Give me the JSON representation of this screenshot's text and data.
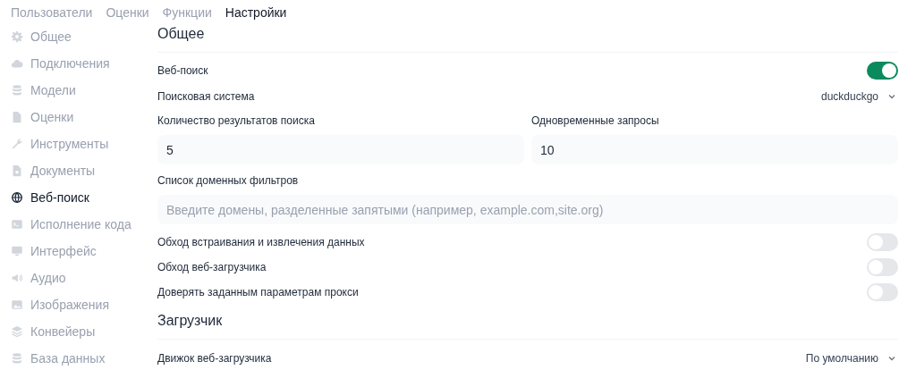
{
  "tabs": [
    {
      "label": "Пользователи",
      "selected": false
    },
    {
      "label": "Оценки",
      "selected": false
    },
    {
      "label": "Функции",
      "selected": false
    },
    {
      "label": "Настройки",
      "selected": true
    }
  ],
  "sidebar": {
    "items": [
      {
        "label": "Общее",
        "selected": false
      },
      {
        "label": "Подключения",
        "selected": false
      },
      {
        "label": "Модели",
        "selected": false
      },
      {
        "label": "Оценки",
        "selected": false
      },
      {
        "label": "Инструменты",
        "selected": false
      },
      {
        "label": "Документы",
        "selected": false
      },
      {
        "label": "Веб-поиск",
        "selected": true
      },
      {
        "label": "Исполнение кода",
        "selected": false
      },
      {
        "label": "Интерфейс",
        "selected": false
      },
      {
        "label": "Аудио",
        "selected": false
      },
      {
        "label": "Изображения",
        "selected": false
      },
      {
        "label": "Конвейеры",
        "selected": false
      },
      {
        "label": "База данных",
        "selected": false
      }
    ]
  },
  "sections": [
    {
      "title": "Общее",
      "items": [
        {
          "kind": "toggle",
          "label": "Веб-поиск",
          "on": true
        },
        {
          "kind": "select",
          "label": "Поисковая система",
          "value": "duckduckgo"
        },
        {
          "kind": "fields",
          "fields": [
            {
              "label": "Количество результатов поиска",
              "value": "5"
            },
            {
              "label": "Одновременные запросы",
              "value": "10"
            }
          ]
        },
        {
          "kind": "fields",
          "fields": [
            {
              "label": "Список доменных фильтров",
              "placeholder": "Введите домены, разделенные запятыми (например, example.com,site.org)"
            }
          ]
        },
        {
          "kind": "toggle",
          "label": "Обход встраивания и извлечения данных",
          "on": false
        },
        {
          "kind": "toggle",
          "label": "Обход веб-загрузчика",
          "on": false
        },
        {
          "kind": "toggle",
          "label": "Доверять заданным параметрам прокси",
          "on": false
        }
      ]
    },
    {
      "title": "Загрузчик",
      "items": [
        {
          "kind": "select",
          "label": "Движок веб-загрузчика",
          "value": "По умолчанию"
        }
      ]
    }
  ]
}
